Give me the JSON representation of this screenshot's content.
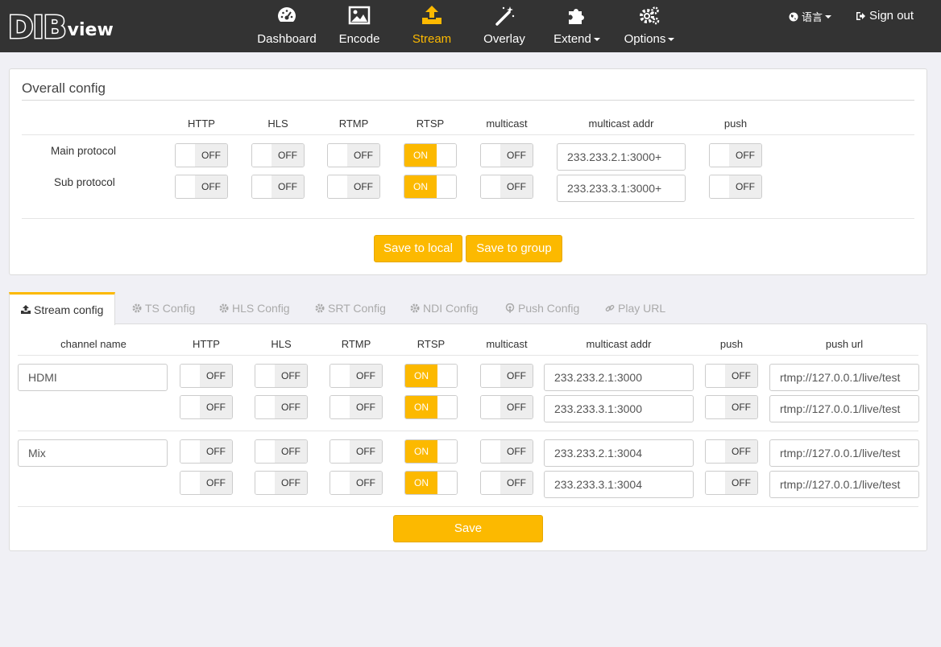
{
  "brand": {
    "logo_main": "DIB",
    "logo_sub": "view"
  },
  "colors": {
    "accent": "#fcb900",
    "navbar": "#333333",
    "toggle_off_bg": "#eeeeee"
  },
  "nav": {
    "items": [
      {
        "label": "Dashboard",
        "icon": "dashboard-icon"
      },
      {
        "label": "Encode",
        "icon": "image-icon"
      },
      {
        "label": "Stream",
        "icon": "upload-icon",
        "active": true
      },
      {
        "label": "Overlay",
        "icon": "magic-wand-icon"
      },
      {
        "label": "Extend",
        "icon": "puzzle-icon"
      },
      {
        "label": "Options",
        "icon": "gears-icon"
      }
    ],
    "language": "语言",
    "sign_out": "Sign out"
  },
  "overall": {
    "title": "Overall config",
    "headers": [
      "HTTP",
      "HLS",
      "RTMP",
      "RTSP",
      "multicast",
      "multicast addr",
      "push"
    ],
    "rows": [
      {
        "label": "Main protocol",
        "http": "OFF",
        "hls": "OFF",
        "rtmp": "OFF",
        "rtsp": "ON",
        "multicast": "OFF",
        "addr": "233.233.2.1:3000+",
        "push": "OFF"
      },
      {
        "label": "Sub protocol",
        "http": "OFF",
        "hls": "OFF",
        "rtmp": "OFF",
        "rtsp": "ON",
        "multicast": "OFF",
        "addr": "233.233.3.1:3000+",
        "push": "OFF"
      }
    ],
    "save_local": "Save to local",
    "save_group": "Save to group"
  },
  "tabs": [
    {
      "label": "Stream config",
      "icon": "upload-icon",
      "active": true
    },
    {
      "label": "TS Config",
      "icon": "gear-icon"
    },
    {
      "label": "HLS Config",
      "icon": "gear-icon"
    },
    {
      "label": "SRT Config",
      "icon": "gear-icon"
    },
    {
      "label": "NDI Config",
      "icon": "gear-icon"
    },
    {
      "label": "Push Config",
      "icon": "podcast-icon"
    },
    {
      "label": "Play URL",
      "icon": "link-icon"
    }
  ],
  "stream": {
    "headers": [
      "channel name",
      "HTTP",
      "HLS",
      "RTMP",
      "RTSP",
      "multicast",
      "multicast addr",
      "push",
      "push url"
    ],
    "channels": [
      {
        "name": "HDMI",
        "rows": [
          {
            "http": "OFF",
            "hls": "OFF",
            "rtmp": "OFF",
            "rtsp": "ON",
            "multicast": "OFF",
            "addr": "233.233.2.1:3000",
            "push": "OFF",
            "url": "rtmp://127.0.0.1/live/test"
          },
          {
            "http": "OFF",
            "hls": "OFF",
            "rtmp": "OFF",
            "rtsp": "ON",
            "multicast": "OFF",
            "addr": "233.233.3.1:3000",
            "push": "OFF",
            "url": "rtmp://127.0.0.1/live/test"
          }
        ]
      },
      {
        "name": "Mix",
        "rows": [
          {
            "http": "OFF",
            "hls": "OFF",
            "rtmp": "OFF",
            "rtsp": "ON",
            "multicast": "OFF",
            "addr": "233.233.2.1:3004",
            "push": "OFF",
            "url": "rtmp://127.0.0.1/live/test"
          },
          {
            "http": "OFF",
            "hls": "OFF",
            "rtmp": "OFF",
            "rtsp": "ON",
            "multicast": "OFF",
            "addr": "233.233.3.1:3004",
            "push": "OFF",
            "url": "rtmp://127.0.0.1/live/test"
          }
        ]
      }
    ],
    "save": "Save"
  }
}
